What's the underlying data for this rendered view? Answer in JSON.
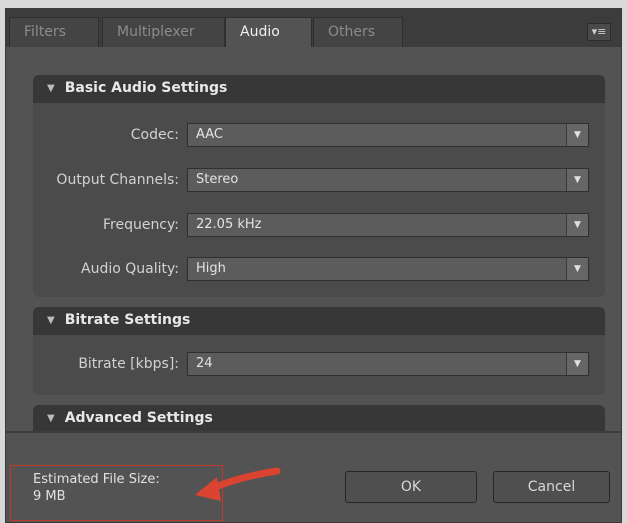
{
  "tabs": [
    {
      "label": "Filters"
    },
    {
      "label": "Multiplexer"
    },
    {
      "label": "Audio"
    },
    {
      "label": "Others"
    }
  ],
  "menu_icon": "panel-menu-icon",
  "sections": {
    "basic": {
      "title": "Basic Audio Settings",
      "rows": [
        {
          "label": "Codec:",
          "value": "AAC"
        },
        {
          "label": "Output Channels:",
          "value": "Stereo"
        },
        {
          "label": "Frequency:",
          "value": "22.05 kHz"
        },
        {
          "label": "Audio Quality:",
          "value": "High"
        }
      ]
    },
    "bitrate": {
      "title": "Bitrate Settings",
      "rows": [
        {
          "label": "Bitrate [kbps]:",
          "value": "24"
        }
      ]
    },
    "advanced": {
      "title": "Advanced Settings"
    }
  },
  "footer": {
    "estimate_label": "Estimated File Size:",
    "estimate_value": "9 MB",
    "ok_label": "OK",
    "cancel_label": "Cancel"
  },
  "colors": {
    "annotation_red": "#d9432f",
    "panel_bg": "#535353"
  }
}
